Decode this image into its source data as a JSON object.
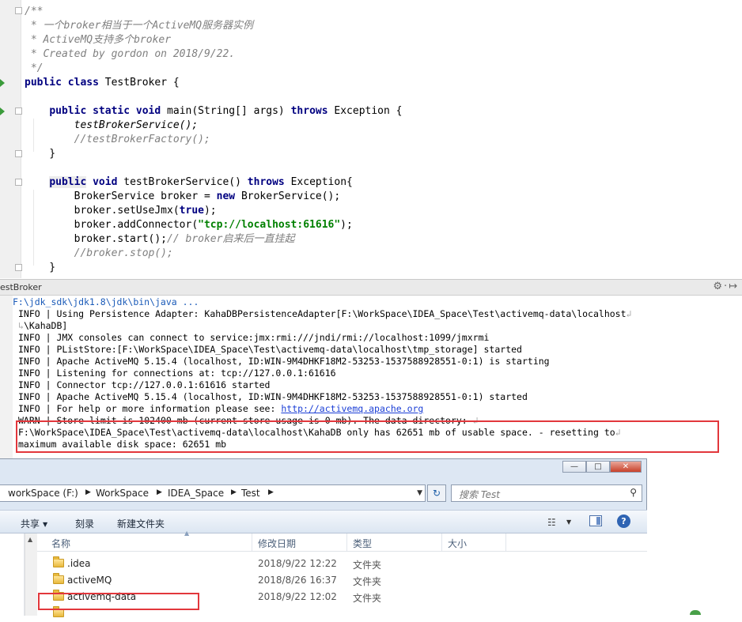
{
  "editor": {
    "lines": [
      {
        "text": "/**",
        "cls": "cm"
      },
      {
        "text": " * 一个broker相当于一个ActiveMQ服务器实例",
        "cls": "cm"
      },
      {
        "text": " * ActiveMQ支持多个broker",
        "cls": "cm"
      },
      {
        "text": " * Created by gordon on 2018/9/22.",
        "cls": "cm"
      },
      {
        "text": " */",
        "cls": "cm"
      },
      {
        "text": "public class TestBroker {"
      },
      {
        "text": ""
      },
      {
        "text": "    public static void main(String[] args) throws Exception {"
      },
      {
        "text": "        testBrokerService();"
      },
      {
        "text": "        //testBrokerFactory();",
        "cls": "cm"
      },
      {
        "text": "    }"
      },
      {
        "text": ""
      },
      {
        "text": "    public void testBrokerService() throws Exception{"
      },
      {
        "text": "        BrokerService broker = new BrokerService();"
      },
      {
        "text": "        broker.setUseJmx(true);"
      },
      {
        "text": "        broker.addConnector(\"tcp://localhost:61616\");"
      },
      {
        "text": "        broker.start();// broker启来后一直挂起"
      },
      {
        "text": "        //broker.stop();",
        "cls": "cm"
      },
      {
        "text": "    }"
      }
    ]
  },
  "run_panel": {
    "title": "estBroker",
    "tools": "⚙·↦"
  },
  "console": {
    "lines": [
      "F:\\jdk_sdk\\jdk1.8\\jdk\\bin\\java ...",
      "INFO | Using Persistence Adapter: KahaDBPersistenceAdapter[F:\\WorkSpace\\IDEA_Space\\Test\\activemq-data\\localhost",
      "\\KahaDB]",
      "INFO | JMX consoles can connect to service:jmx:rmi:///jndi/rmi://localhost:1099/jmxrmi",
      "INFO | PListStore:[F:\\WorkSpace\\IDEA_Space\\Test\\activemq-data\\localhost\\tmp_storage] started",
      "INFO | Apache ActiveMQ 5.15.4 (localhost, ID:WIN-9M4DHKF18M2-53253-1537588928551-0:1) is starting",
      "INFO | Listening for connections at: tcp://127.0.0.1:61616",
      "INFO | Connector tcp://127.0.0.1:61616 started",
      "INFO | Apache ActiveMQ 5.15.4 (localhost, ID:WIN-9M4DHKF18M2-53253-1537588928551-0:1) started",
      "INFO | For help or more information please see: ",
      "WARN | Store limit is 102400 mb (current store usage is 0 mb). The data directory: ",
      "F:\\WorkSpace\\IDEA_Space\\Test\\activemq-data\\localhost\\KahaDB only has 62651 mb of usable space. - resetting to",
      "maximum available disk space: 62651 mb"
    ],
    "link": "http://activemq.apache.org"
  },
  "explorer": {
    "window_buttons": [
      "—",
      "□",
      "✕"
    ],
    "breadcrumbs": [
      "workSpace (F:)",
      "WorkSpace",
      "IDEA_Space",
      "Test"
    ],
    "search_placeholder": "搜索 Test",
    "toolbar": {
      "share": "共享",
      "burn": "刻录",
      "new_folder": "新建文件夹"
    },
    "columns": {
      "name": "名称",
      "modified": "修改日期",
      "type": "类型",
      "size": "大小"
    },
    "files": [
      {
        "name": ".idea",
        "modified": "2018/9/22 12:22",
        "type": "文件夹"
      },
      {
        "name": "activeMQ",
        "modified": "2018/8/26 16:37",
        "type": "文件夹"
      },
      {
        "name": "activemq-data",
        "modified": "2018/9/22 12:02",
        "type": "文件夹"
      }
    ]
  }
}
